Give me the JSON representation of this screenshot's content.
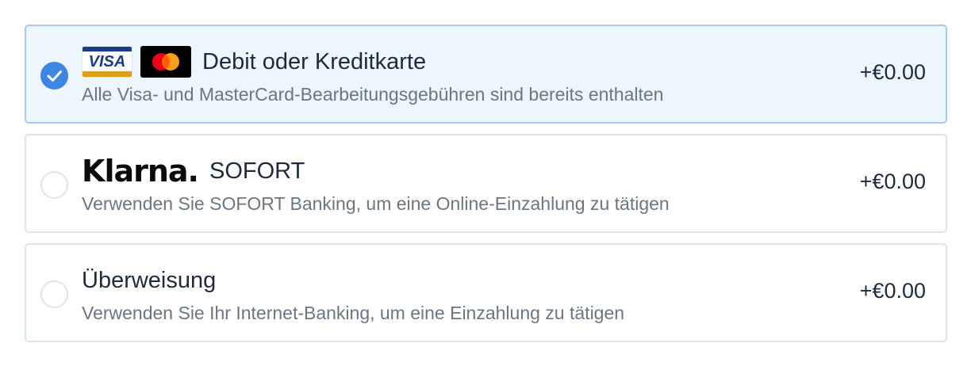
{
  "payment_options": [
    {
      "selected": true,
      "logos": [
        "visa-logo",
        "mastercard-logo"
      ],
      "visa_logo_text": "VISA",
      "title": "Debit oder Kreditkarte",
      "description": "Alle Visa- und MasterCard-Bearbeitungsgebühren sind bereits enthalten",
      "price": "+€0.00"
    },
    {
      "selected": false,
      "logo_text": "Klarna.",
      "title": "SOFORT",
      "description": "Verwenden Sie SOFORT Banking, um eine Online-Einzahlung zu tätigen",
      "price": "+€0.00"
    },
    {
      "selected": false,
      "title": "Überweisung",
      "description": "Verwenden Sie Ihr Internet-Banking, um eine Einzahlung zu tätigen",
      "price": "+€0.00"
    }
  ],
  "colors": {
    "selected_border": "#a8c8ec",
    "selected_background": "#edf5fd",
    "radio_checked": "#3d86e2",
    "text_primary": "#1d2b3c",
    "text_secondary": "#6b7683"
  }
}
